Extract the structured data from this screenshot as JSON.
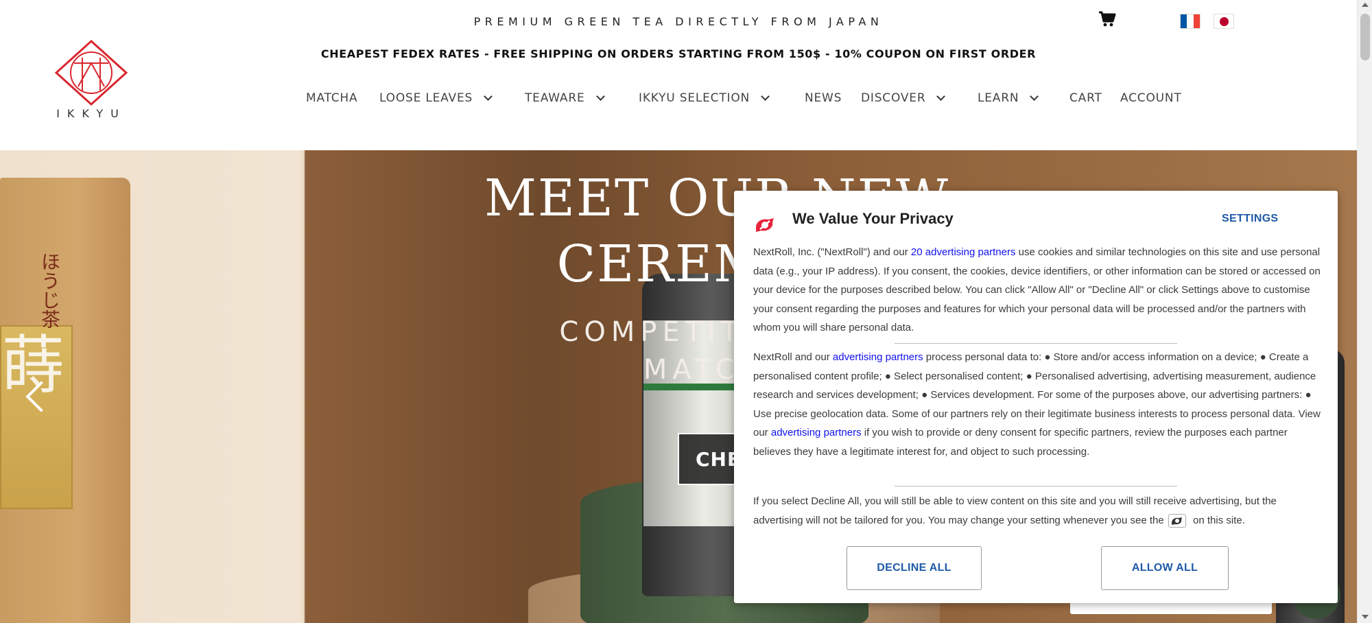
{
  "header": {
    "tagline": "PREMIUM GREEN TEA DIRECTLY FROM JAPAN",
    "promo": "CHEAPEST FEDEX RATES - FREE SHIPPING ON ORDERS STARTING FROM 150$ - 10% COUPON ON FIRST ORDER",
    "logo_text": "IKKYU",
    "cart_icon": "cart-icon",
    "languages": [
      {
        "name": "flag-fr-icon",
        "colors": [
          "#0055A4",
          "#FFFFFF",
          "#EF4135"
        ]
      },
      {
        "name": "flag-jp-icon",
        "colors": [
          "#FFFFFF",
          "#BC002D"
        ]
      }
    ]
  },
  "nav": {
    "items": [
      {
        "label": "MATCHA",
        "dropdown": false
      },
      {
        "label": "LOOSE LEAVES",
        "dropdown": true
      },
      {
        "label": "TEAWARE",
        "dropdown": true
      },
      {
        "label": "IKKYU SELECTION",
        "dropdown": true
      },
      {
        "label": "NEWS",
        "dropdown": false
      },
      {
        "label": "DISCOVER",
        "dropdown": true
      },
      {
        "label": "LEARN",
        "dropdown": true
      },
      {
        "label": "CART",
        "dropdown": false
      },
      {
        "label": "ACCOUNT",
        "dropdown": false
      }
    ]
  },
  "hero": {
    "title_line1": "MEET OUR NEW",
    "title_line2": "CEREMONI",
    "subtitle_line1": "COMPETITION AN",
    "subtitle_line2": "MATCHA",
    "cta_label": "CHE",
    "side_label_text": "ほうじ茶",
    "side_label_big": "蒔"
  },
  "consent": {
    "title": "We Value Your Privacy",
    "settings_label": "SETTINGS",
    "p1_a": "NextRoll, Inc. (\"NextRoll\") and our ",
    "p1_link": "20 advertising partners",
    "p1_b": " use cookies and similar technologies on this site and use personal data (e.g., your IP address). If you consent, the cookies, device identifiers, or other information can be stored or accessed on your device for the purposes described below. You can click \"Allow All\" or \"Decline All\" or click Settings above to customise your consent regarding the purposes and features for which your personal data will be processed and/or the partners with whom you will share personal data.",
    "p2_a": "NextRoll and our ",
    "p2_link1": "advertising partners",
    "p2_b": " process personal data to: ● Store and/or access information on a device; ● Create a personalised content profile; ● Select personalised content; ● Personalised advertising, advertising measurement, audience research and services development; ● Services development. For some of the purposes above, our advertising partners: ● Use precise geolocation data. Some of our partners rely on their legitimate business interests to process personal data. View our ",
    "p2_link2": "advertising partners",
    "p2_c": " if you wish to provide or deny consent for specific partners, review the purposes each partner believes they have a legitimate interest for, and object to such processing.",
    "p3_a": "If you select Decline All, you will still be able to view content on this site and you will still receive advertising, but the advertising will not be tailored for you. You may change your setting whenever you see the ",
    "p3_b": " on this site.",
    "decline_label": "DECLINE ALL",
    "allow_label": "ALLOW ALL",
    "brand_color": "#E6243B",
    "link_color": "#1111EE",
    "button_color": "#1E5AA7"
  }
}
